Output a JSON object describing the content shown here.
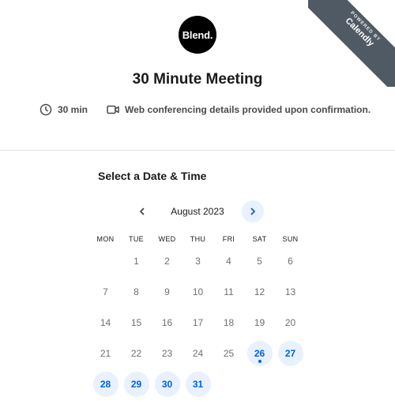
{
  "ribbon": {
    "small": "POWERED BY",
    "big": "Calendly"
  },
  "logo": {
    "text": "Blend."
  },
  "event": {
    "title": "30 Minute Meeting",
    "duration": "30 min",
    "location": "Web conferencing details provided upon confirmation."
  },
  "scheduler": {
    "heading": "Select a Date & Time",
    "month": "August 2023",
    "prev_icon": "chevron-left-icon",
    "next_icon": "chevron-right-icon",
    "weekdays": [
      "MON",
      "TUE",
      "WED",
      "THU",
      "FRI",
      "SAT",
      "SUN"
    ],
    "weeks": [
      [
        {
          "d": ""
        },
        {
          "d": "1"
        },
        {
          "d": "2"
        },
        {
          "d": "3"
        },
        {
          "d": "4"
        },
        {
          "d": "5"
        },
        {
          "d": "6"
        }
      ],
      [
        {
          "d": "7"
        },
        {
          "d": "8"
        },
        {
          "d": "9"
        },
        {
          "d": "10"
        },
        {
          "d": "11"
        },
        {
          "d": "12"
        },
        {
          "d": "13"
        }
      ],
      [
        {
          "d": "14"
        },
        {
          "d": "15"
        },
        {
          "d": "16"
        },
        {
          "d": "17"
        },
        {
          "d": "18"
        },
        {
          "d": "19"
        },
        {
          "d": "20"
        }
      ],
      [
        {
          "d": "21"
        },
        {
          "d": "22"
        },
        {
          "d": "23"
        },
        {
          "d": "24"
        },
        {
          "d": "25"
        },
        {
          "d": "26",
          "available": true,
          "today": true
        },
        {
          "d": "27",
          "available": true
        }
      ],
      [
        {
          "d": "28",
          "available": true
        },
        {
          "d": "29",
          "available": true
        },
        {
          "d": "30",
          "available": true
        },
        {
          "d": "31",
          "available": true
        },
        {
          "d": ""
        },
        {
          "d": ""
        },
        {
          "d": ""
        }
      ]
    ]
  },
  "colors": {
    "accent": "#0060e6",
    "accent_bg": "#e8f1fd",
    "ribbon": "#505a64"
  }
}
